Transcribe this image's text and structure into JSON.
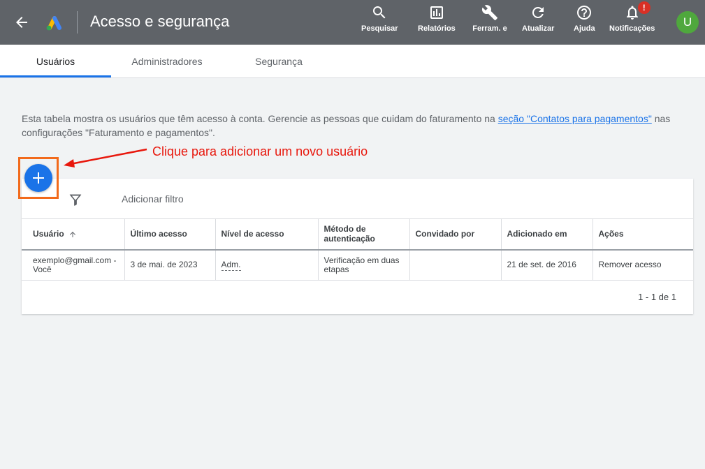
{
  "header": {
    "title": "Acesso e segurança",
    "tools": [
      {
        "icon": "search-icon",
        "label": "Pesquisar"
      },
      {
        "icon": "reports-icon",
        "label": "Relatórios"
      },
      {
        "icon": "wrench-icon",
        "label": "Ferram. e"
      },
      {
        "icon": "refresh-icon",
        "label": "Atualizar"
      },
      {
        "icon": "help-icon",
        "label": "Ajuda"
      },
      {
        "icon": "bell-icon",
        "label": "Notificações"
      }
    ],
    "notification_badge": "!",
    "avatar_letter": "U"
  },
  "tabs": [
    {
      "label": "Usuários",
      "active": true
    },
    {
      "label": "Administradores",
      "active": false
    },
    {
      "label": "Segurança",
      "active": false
    }
  ],
  "description": {
    "text_before": "Esta tabela mostra os usuários que têm acesso à conta. Gerencie as pessoas que cuidam do faturamento na ",
    "link_text": "seção \"Contatos para pagamentos\"",
    "text_after": " nas configurações \"Faturamento e pagamentos\"."
  },
  "annotation": "Clique para adicionar um novo usuário",
  "filter": {
    "label": "Adicionar filtro"
  },
  "table": {
    "columns": [
      "Usuário",
      "Último acesso",
      "Nível de acesso",
      "Método de autenticação",
      "Convidado por",
      "Adicionado em",
      "Ações"
    ],
    "rows": [
      {
        "user": "exemplo@gmail.com - Você",
        "last_access": "3 de mai. de 2023",
        "access_level": "Adm.",
        "auth_method": "Verificação em duas etapas",
        "invited_by": "",
        "added_on": "21 de set. de 2016",
        "action": "Remover acesso"
      }
    ]
  },
  "pagination": "1 - 1 de 1",
  "colors": {
    "topbar": "#5f6368",
    "accent": "#1a73e8",
    "annotation": "#e8170c",
    "highlight": "#f26a1b",
    "avatar": "#4fa83d",
    "badge": "#d93025"
  }
}
